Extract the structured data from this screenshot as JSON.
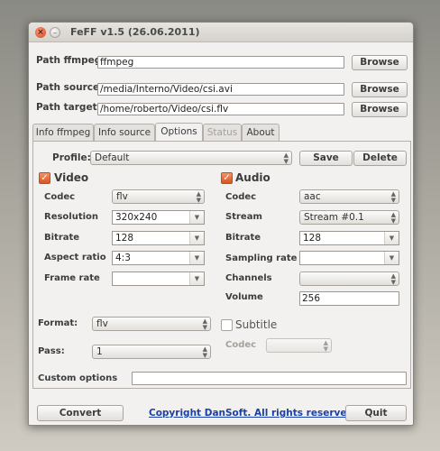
{
  "window": {
    "title": "FeFF  v1.5 (26.06.2011)",
    "close_glyph": "×",
    "minimize_glyph": "–"
  },
  "paths": {
    "ffmpeg_label": "Path ffmpeg",
    "ffmpeg_value": "ffmpeg",
    "source_label": "Path source",
    "source_value": "/media/Interno/Video/csi.avi",
    "target_label": "Path target",
    "target_value": "/home/roberto/Video/csi.flv",
    "browse_label": "Browse"
  },
  "tabs": [
    "Info ffmpeg",
    "Info source",
    "Options",
    "Status",
    "About"
  ],
  "active_tab": "Options",
  "profile": {
    "label": "Profile:",
    "value": "Default",
    "save_label": "Save",
    "delete_label": "Delete"
  },
  "video": {
    "title": "Video",
    "checked": true,
    "codec_label": "Codec",
    "codec_value": "flv",
    "resolution_label": "Resolution",
    "resolution_value": "320x240",
    "bitrate_label": "Bitrate",
    "bitrate_value": "128",
    "aspect_label": "Aspect ratio",
    "aspect_value": "4:3",
    "framerate_label": "Frame rate",
    "framerate_value": ""
  },
  "audio": {
    "title": "Audio",
    "checked": true,
    "codec_label": "Codec",
    "codec_value": "aac",
    "stream_label": "Stream",
    "stream_value": "Stream #0.1",
    "bitrate_label": "Bitrate",
    "bitrate_value": "128",
    "sampling_label": "Sampling rate",
    "sampling_value": "",
    "channels_label": "Channels",
    "channels_value": "",
    "volume_label": "Volume",
    "volume_value": "256"
  },
  "format": {
    "label": "Format:",
    "value": "flv"
  },
  "pass": {
    "label": "Pass:",
    "value": "1"
  },
  "subtitle": {
    "title": "Subtitle",
    "checked": false,
    "codec_label": "Codec",
    "codec_value": ""
  },
  "custom": {
    "label": "Custom options",
    "value": ""
  },
  "footer": {
    "convert_label": "Convert",
    "copyright": "Copyright DanSoft. All rights reserved.",
    "quit_label": "Quit"
  },
  "colors": {
    "accent_orange": "#e0632a",
    "link_blue": "#1b3fa8"
  }
}
